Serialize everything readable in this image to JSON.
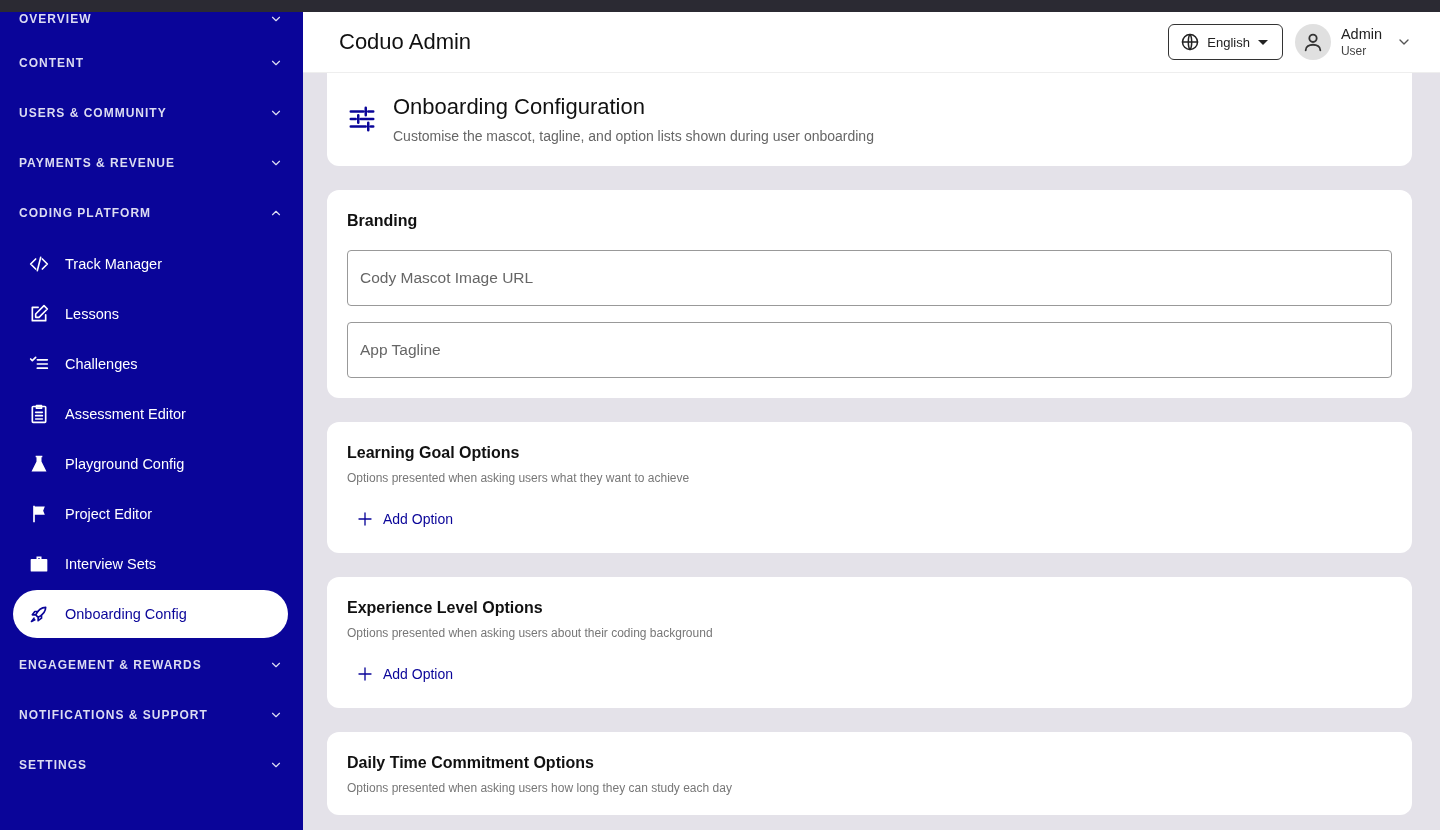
{
  "sidebar": {
    "sections": [
      {
        "label": "OVERVIEW",
        "expanded": false
      },
      {
        "label": "CONTENT",
        "expanded": false
      },
      {
        "label": "USERS & COMMUNITY",
        "expanded": false
      },
      {
        "label": "PAYMENTS & REVENUE",
        "expanded": false
      },
      {
        "label": "CODING PLATFORM",
        "expanded": true,
        "items": [
          {
            "label": "Track Manager",
            "selected": false
          },
          {
            "label": "Lessons",
            "selected": false
          },
          {
            "label": "Challenges",
            "selected": false
          },
          {
            "label": "Assessment Editor",
            "selected": false
          },
          {
            "label": "Playground Config",
            "selected": false
          },
          {
            "label": "Project Editor",
            "selected": false
          },
          {
            "label": "Interview Sets",
            "selected": false
          },
          {
            "label": "Onboarding Config",
            "selected": true
          }
        ]
      },
      {
        "label": "ENGAGEMENT & REWARDS",
        "expanded": false
      },
      {
        "label": "NOTIFICATIONS & SUPPORT",
        "expanded": false
      },
      {
        "label": "SETTINGS",
        "expanded": false
      }
    ]
  },
  "header": {
    "title": "Coduo Admin",
    "language": "English",
    "user": {
      "name": "Admin",
      "role": "User"
    }
  },
  "page": {
    "title": "Onboarding Configuration",
    "subtitle": "Customise the mascot, tagline, and option lists shown during user onboarding"
  },
  "sections": [
    {
      "kind": "fields",
      "title": "Branding",
      "fields": [
        {
          "placeholder": "Cody Mascot Image URL"
        },
        {
          "placeholder": "App Tagline"
        }
      ]
    },
    {
      "kind": "options",
      "title": "Learning Goal Options",
      "description": "Options presented when asking users what they want to achieve",
      "add_label": "Add Option"
    },
    {
      "kind": "options",
      "title": "Experience Level Options",
      "description": "Options presented when asking users about their coding background",
      "add_label": "Add Option"
    },
    {
      "kind": "options",
      "title": "Daily Time Commitment Options",
      "description": "Options presented when asking users how long they can study each day"
    }
  ]
}
